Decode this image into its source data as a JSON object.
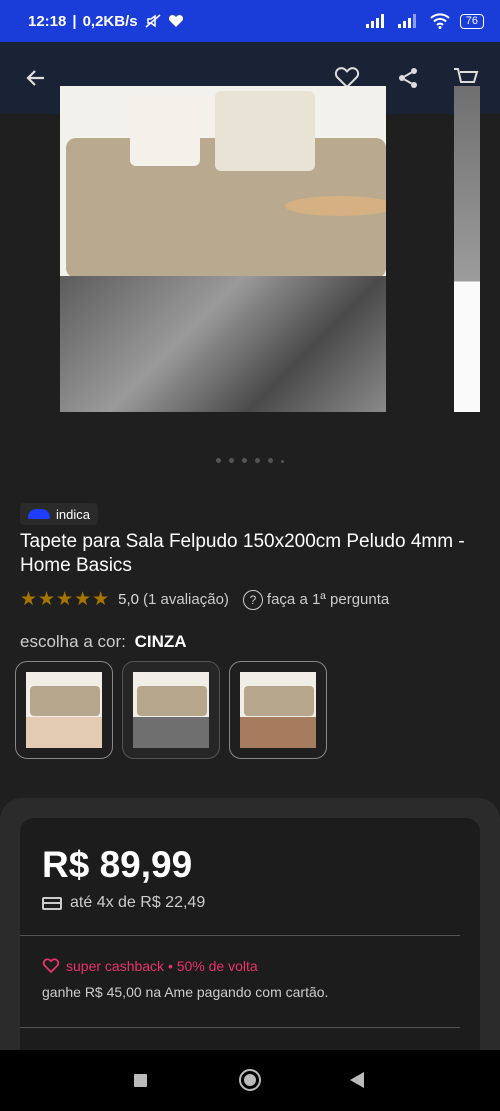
{
  "status_bar": {
    "time": "12:18",
    "speed": "0,2KB/s",
    "battery": "76"
  },
  "header": {
    "back_icon": "arrow-left-icon",
    "favorite_icon": "heart-icon",
    "share_icon": "share-icon",
    "cart_icon": "cart-icon"
  },
  "gallery": {
    "total_dots": 6,
    "active_dot": 0
  },
  "product": {
    "badge_label": "indica",
    "title": "Tapete para Sala Felpudo 150x200cm Peludo 4mm - Home Basics",
    "stars": "★★★★★",
    "rating_value": "5,0",
    "rating_count": "(1 avaliação)",
    "question_link": "faça a 1ª pergunta"
  },
  "color_select": {
    "label": "escolha a cor:",
    "selected": "CINZA",
    "swatches": [
      {
        "name": "bege",
        "rug_color": "#e4cbb4"
      },
      {
        "name": "cinza",
        "rug_color": "#6f6f6f"
      },
      {
        "name": "marrom",
        "rug_color": "#a67b5e"
      }
    ]
  },
  "pricing": {
    "price": "R$ 89,99",
    "installments": "até 4x de R$ 22,49",
    "cashback": "super cashback • 50% de volta",
    "cashback_note": "ganhe R$ 45,00 na Ame pagando com cartão."
  },
  "colors": {
    "status_bar": "#1a3cd8",
    "cashback": "#e8336b",
    "badge_logo": "#1e3dff"
  }
}
